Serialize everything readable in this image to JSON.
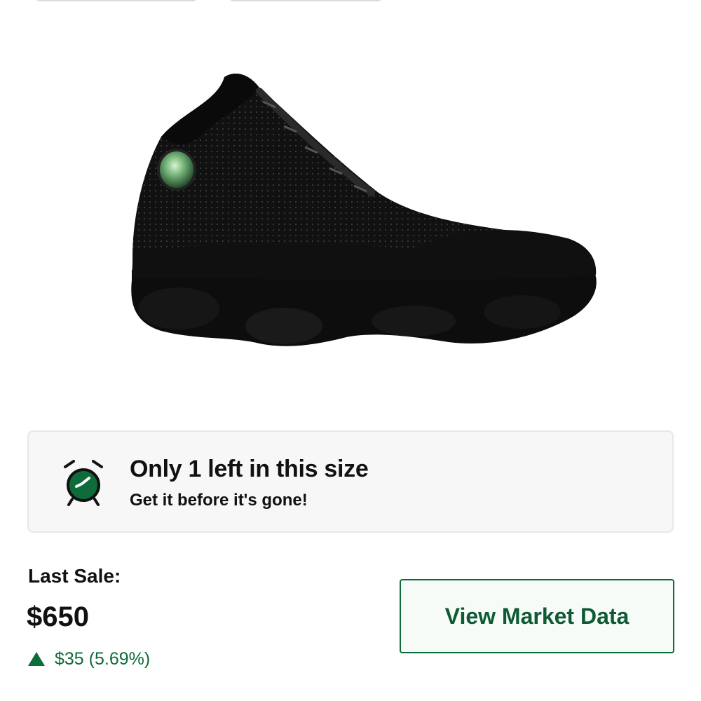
{
  "alert": {
    "title": "Only 1 left in this size",
    "subtitle": "Get it before it's gone!",
    "icon": "alarm-clock-icon",
    "icon_color": "#0e6b3a"
  },
  "last_sale": {
    "label": "Last Sale:",
    "price": "$650",
    "change": "$35 (5.69%)",
    "change_direction_icon": "triangle-up-icon",
    "change_color": "#0e6b3a"
  },
  "market_button": {
    "label": "View Market Data",
    "color": "#0e6b3a"
  }
}
